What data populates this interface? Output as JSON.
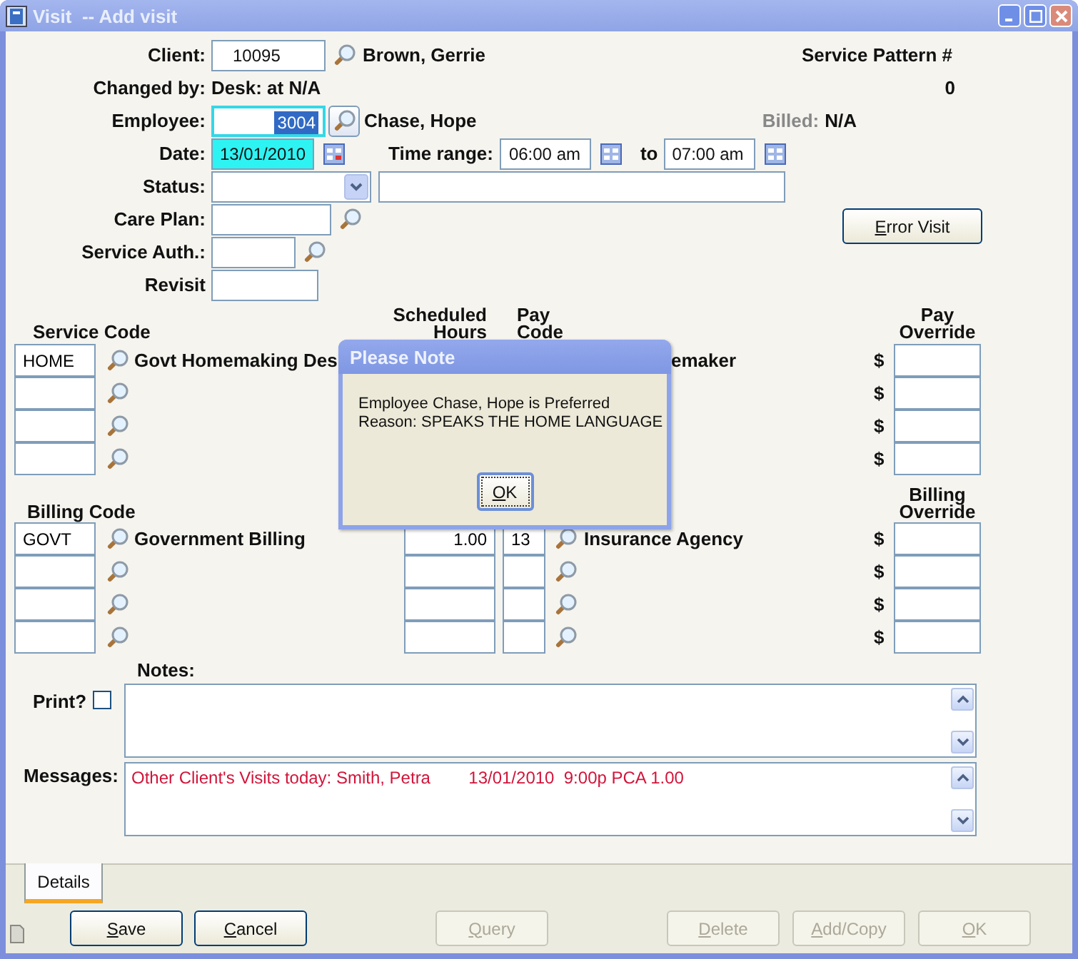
{
  "window": {
    "title": "Visit  -- Add visit"
  },
  "client": {
    "label": "Client:",
    "value": "10095",
    "name": "Brown, Gerrie"
  },
  "service_pattern": {
    "label": "Service Pattern #",
    "value": "0"
  },
  "changed_by": {
    "label": "Changed by:",
    "value": "Desk: at N/A"
  },
  "employee": {
    "label": "Employee:",
    "value": "3004",
    "name": "Chase, Hope",
    "selected": true
  },
  "billed": {
    "label": "Billed:",
    "value": "N/A"
  },
  "date": {
    "label": "Date:",
    "value": "13/01/2010"
  },
  "time_range": {
    "label": "Time range:",
    "from": "06:00 am",
    "to_label": "to",
    "to": "07:00 am"
  },
  "status": {
    "label": "Status:"
  },
  "care_plan": {
    "label": "Care Plan:"
  },
  "error_visit_button": "Error Visit",
  "service_auth": {
    "label": "Service Auth.:"
  },
  "revisit": {
    "label": "Revisit"
  },
  "service_lines": {
    "headers": {
      "code": "Service Code",
      "hours": [
        "Scheduled",
        "Hours"
      ],
      "pay_code": [
        "Pay",
        "Code"
      ],
      "override": [
        "Pay",
        "Override"
      ]
    },
    "rows": [
      {
        "code": "HOME",
        "description": "Govt Homemaking Des",
        "pay_code_description": "emaker",
        "currency": "$"
      },
      {
        "currency": "$"
      },
      {
        "currency": "$"
      },
      {
        "currency": "$"
      }
    ]
  },
  "billing_lines": {
    "headers": {
      "code": "Billing Code",
      "override": [
        "Billing",
        "Override"
      ]
    },
    "rows": [
      {
        "code": "GOVT",
        "description": "Government Billing",
        "hours": "1.00",
        "pay_code": "13",
        "pay_code_description": "Insurance Agency",
        "currency": "$"
      },
      {
        "currency": "$"
      },
      {
        "currency": "$"
      },
      {
        "currency": "$"
      }
    ]
  },
  "notes": {
    "label": "Notes:"
  },
  "print": {
    "label": "Print?",
    "checked": false
  },
  "messages": {
    "label": "Messages:",
    "text": "Other Client's Visits today: Smith, Petra        13/01/2010  9:00p PCA 1.00"
  },
  "tabs": [
    {
      "label": "Details",
      "selected": true
    }
  ],
  "buttons": [
    {
      "label": "Save",
      "disabled": false
    },
    {
      "label": "Cancel",
      "disabled": false
    },
    {
      "label": "Query",
      "disabled": true
    },
    {
      "label": "Delete",
      "disabled": true
    },
    {
      "label": "Add/Copy",
      "disabled": true
    },
    {
      "label": "OK",
      "disabled": true
    }
  ],
  "dialog": {
    "title": "Please Note",
    "lines": [
      "Employee Chase, Hope is Preferred",
      "Reason: SPEAKS THE HOME LANGUAGE"
    ],
    "button": "OK"
  }
}
